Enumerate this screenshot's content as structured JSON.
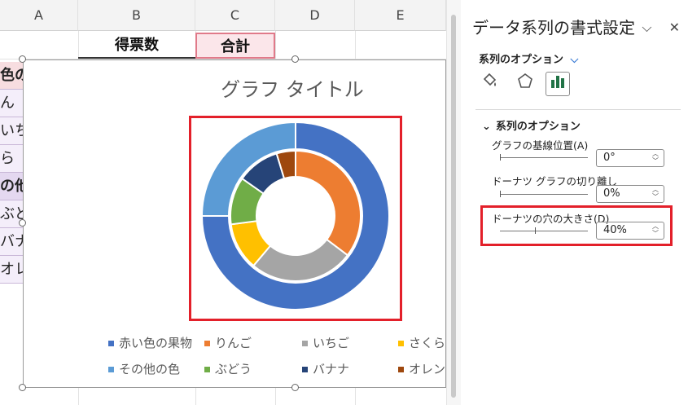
{
  "sheet": {
    "columns": [
      "A",
      "B",
      "C",
      "D",
      "E"
    ],
    "header_cells": {
      "votes": "得票数",
      "total": "合計"
    },
    "left_cells": [
      "色の",
      "ん",
      "いち",
      "ら",
      "の他",
      "ぶど",
      "バナ",
      "オレン"
    ]
  },
  "chart": {
    "title": "グラフ タイトル",
    "legend": [
      {
        "label": "赤い色の果物",
        "color": "#4472C4"
      },
      {
        "label": "りんご",
        "color": "#ED7D31"
      },
      {
        "label": "いちご",
        "color": "#A5A5A5"
      },
      {
        "label": "さくら",
        "color": "#FFC000"
      },
      {
        "label": "その他の色",
        "color": "#5B9BD5"
      },
      {
        "label": "ぶどう",
        "color": "#70AD47"
      },
      {
        "label": "バナナ",
        "color": "#264478"
      },
      {
        "label": "オレン",
        "color": "#9E480E"
      }
    ]
  },
  "chart_data": {
    "type": "pie",
    "title": "グラフ タイトル",
    "series": [
      {
        "categories": [
          "赤い色の果物",
          "その他の色"
        ],
        "values": [
          75,
          25
        ],
        "colors": [
          "#4472C4",
          "#5B9BD5"
        ]
      },
      {
        "categories": [
          "りんご",
          "いちご",
          "さくら",
          "ぶどう",
          "バナナ",
          "オレン"
        ],
        "values": [
          30,
          22,
          10,
          10,
          9,
          4
        ],
        "colors": [
          "#ED7D31",
          "#A5A5A5",
          "#FFC000",
          "#70AD47",
          "#264478",
          "#9E480E"
        ]
      }
    ],
    "hole_size_percent": 40
  },
  "pane": {
    "title": "データ系列の書式設定",
    "series_options_dropdown": "系列のオプション",
    "section": "系列のオプション",
    "fields": [
      {
        "label": "グラフの基線位置(A)",
        "value": "0°",
        "level": 0
      },
      {
        "label": "ドーナツ グラフの切り離し",
        "value": "0%",
        "level": 0
      },
      {
        "label": "ドーナツの穴の大きさ(D)",
        "value": "40%",
        "level": 0.4
      }
    ]
  }
}
